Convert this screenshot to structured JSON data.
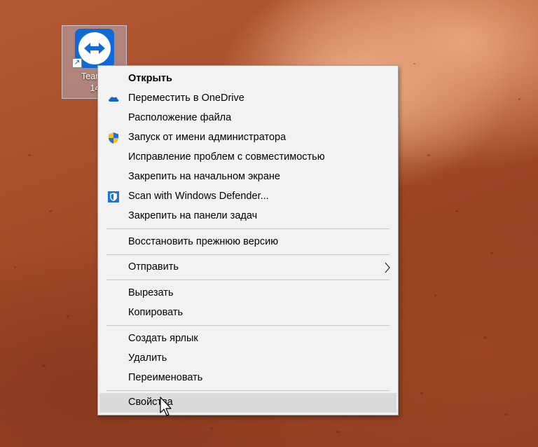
{
  "desktop": {
    "icon": {
      "label_line1": "TeamV",
      "label_line2": "14",
      "icon_name": "teamviewer-icon"
    }
  },
  "context_menu": {
    "items": [
      {
        "label": "Открыть",
        "bold": true
      },
      {
        "label": "Переместить в OneDrive",
        "icon": "onedrive-cloud-icon"
      },
      {
        "label": "Расположение файла"
      },
      {
        "label": "Запуск от имени администратора",
        "icon": "uac-shield-icon"
      },
      {
        "label": "Исправление проблем с совместимостью"
      },
      {
        "label": "Закрепить на начальном экране"
      },
      {
        "label": "Scan with Windows Defender...",
        "icon": "defender-shield-icon"
      },
      {
        "label": "Закрепить на панели задач"
      },
      {
        "label": "Восстановить прежнюю версию"
      },
      {
        "label": "Отправить",
        "submenu": true
      },
      {
        "label": "Вырезать"
      },
      {
        "label": "Копировать"
      },
      {
        "label": "Создать ярлык"
      },
      {
        "label": "Удалить"
      },
      {
        "label": "Переименовать"
      },
      {
        "label": "Свойства",
        "highlighted": true
      }
    ]
  },
  "colors": {
    "menu_background": "#f2f2f2",
    "menu_hover": "#dadada",
    "teamviewer_blue": "#0e6bd8"
  }
}
